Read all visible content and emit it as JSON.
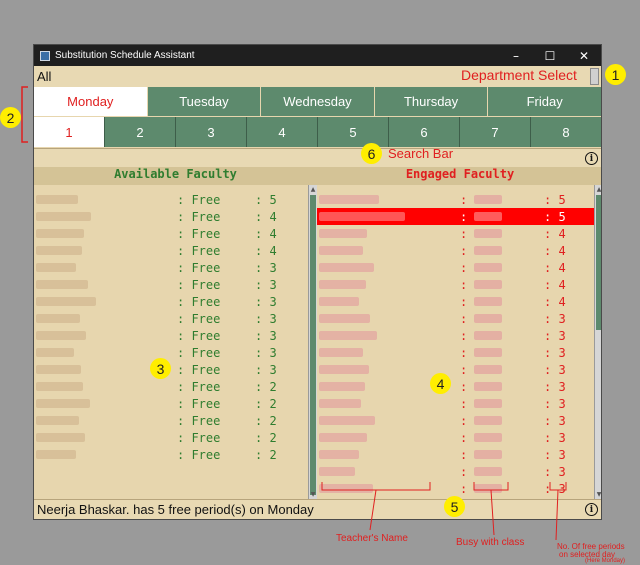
{
  "window": {
    "title": "Substitution Schedule Assistant",
    "minimize": "–",
    "maximize": "☐",
    "close": "✕"
  },
  "department": {
    "value": "All",
    "annotation": "Department Select"
  },
  "days": [
    "Monday",
    "Tuesday",
    "Wednesday",
    "Thursday",
    "Friday"
  ],
  "selected_day": "Monday",
  "periods": [
    "1",
    "2",
    "3",
    "4",
    "5",
    "6",
    "7",
    "8"
  ],
  "selected_period": "1",
  "search": {
    "annotation": "Search Bar"
  },
  "available": {
    "header": "Available Faculty",
    "rows": [
      {
        "status": ": Free",
        "count": ": 5"
      },
      {
        "status": ": Free",
        "count": ": 4"
      },
      {
        "status": ": Free",
        "count": ": 4"
      },
      {
        "status": ": Free",
        "count": ": 4"
      },
      {
        "status": ": Free",
        "count": ": 3"
      },
      {
        "status": ": Free",
        "count": ": 3"
      },
      {
        "status": ": Free",
        "count": ": 3"
      },
      {
        "status": ": Free",
        "count": ": 3"
      },
      {
        "status": ": Free",
        "count": ": 3"
      },
      {
        "status": ": Free",
        "count": ": 3"
      },
      {
        "status": ": Free",
        "count": ": 3"
      },
      {
        "status": ": Free",
        "count": ": 2"
      },
      {
        "status": ": Free",
        "count": ": 2"
      },
      {
        "status": ": Free",
        "count": ": 2"
      },
      {
        "status": ": Free",
        "count": ": 2"
      },
      {
        "status": ": Free",
        "count": ": 2"
      }
    ]
  },
  "engaged": {
    "header": "Engaged Faculty",
    "rows": [
      {
        "sep": ":",
        "count": ": 5"
      },
      {
        "sep": ":",
        "count": ": 5"
      },
      {
        "sep": ":",
        "count": ": 4"
      },
      {
        "sep": ":",
        "count": ": 4"
      },
      {
        "sep": ":",
        "count": ": 4"
      },
      {
        "sep": ":",
        "count": ": 4"
      },
      {
        "sep": ":",
        "count": ": 4"
      },
      {
        "sep": ":",
        "count": ": 3"
      },
      {
        "sep": ":",
        "count": ": 3"
      },
      {
        "sep": ":",
        "count": ": 3"
      },
      {
        "sep": ":",
        "count": ": 3"
      },
      {
        "sep": ":",
        "count": ": 3"
      },
      {
        "sep": ":",
        "count": ": 3"
      },
      {
        "sep": ":",
        "count": ": 3"
      },
      {
        "sep": ":",
        "count": ": 3"
      },
      {
        "sep": ":",
        "count": ": 3"
      },
      {
        "sep": ":",
        "count": ": 3"
      },
      {
        "sep": ":",
        "count": ": 3"
      }
    ],
    "highlighted_index": 1
  },
  "status_bar": {
    "text": "Neerja Bhaskar. has 5 free period(s) on Monday"
  },
  "annotations": {
    "badges": [
      "1",
      "2",
      "3",
      "3",
      "4",
      "5",
      "6"
    ],
    "teacher_name": "Teacher's Name",
    "busy_with_class": "Busy with class",
    "free_periods_line1": "No. Of free periods",
    "free_periods_line2": "on selected day",
    "free_periods_line3": "(Here Monday)"
  },
  "colors": {
    "tab_green": "#5d8a6d",
    "panel_beige": "#e7d6ae",
    "accent_red": "#e02020",
    "free_green": "#2f7d2f"
  }
}
